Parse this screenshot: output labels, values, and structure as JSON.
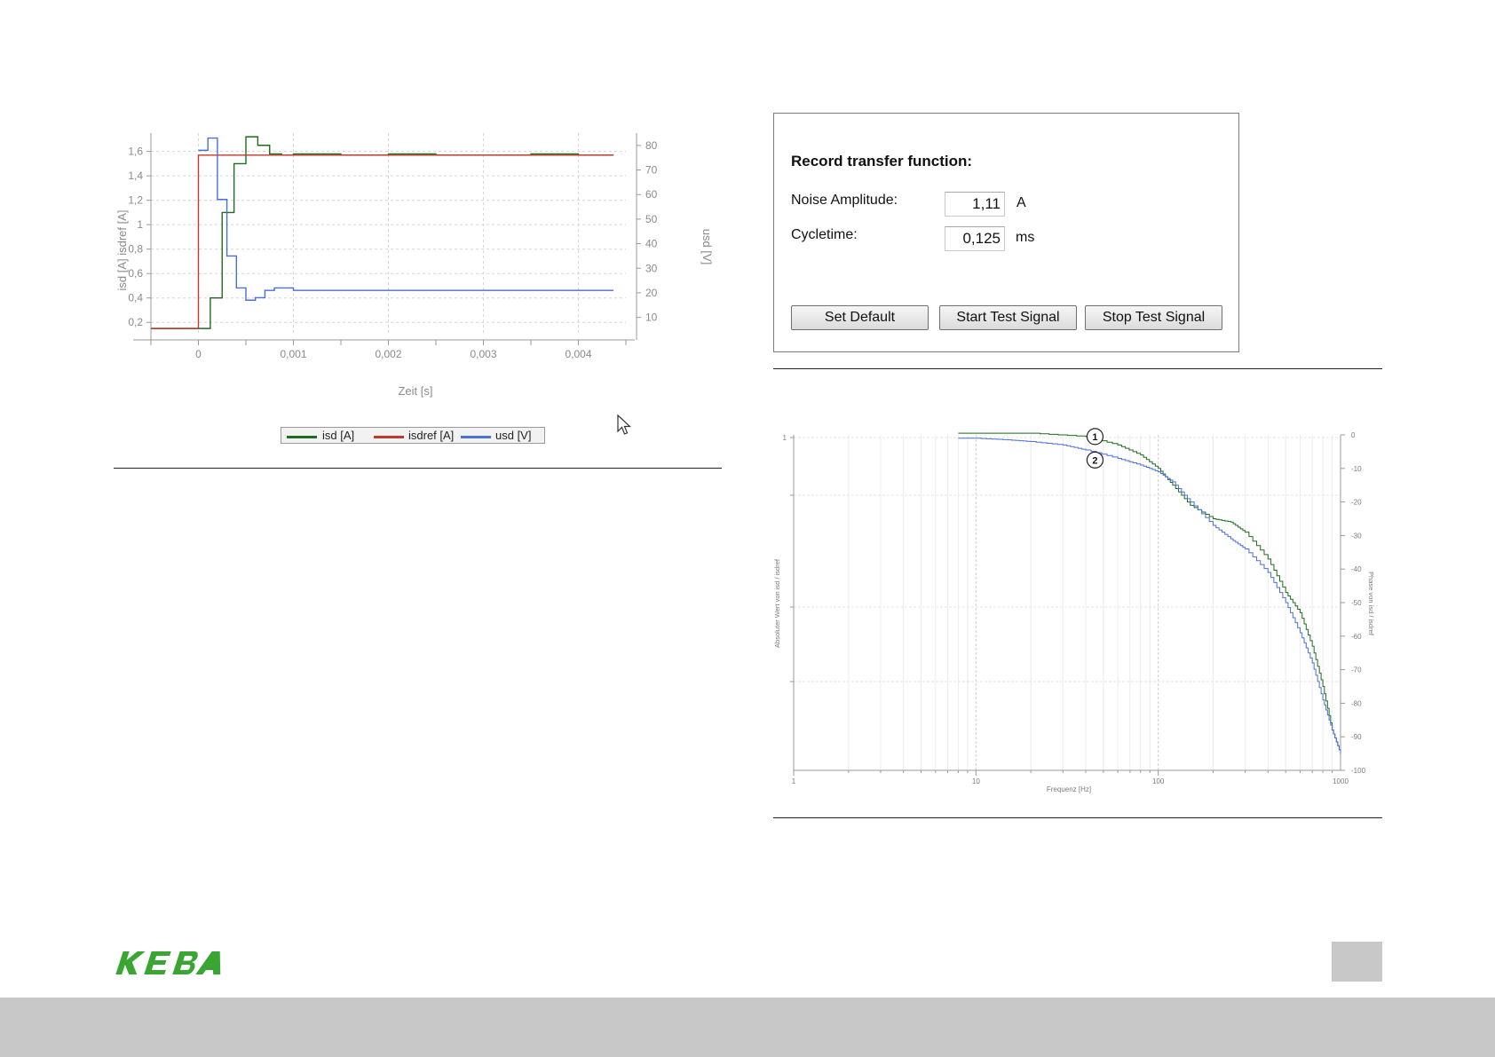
{
  "step_chart": {
    "x_ticks": [
      "0",
      "0,001",
      "0,002",
      "0,003",
      "0,004"
    ],
    "y_left_ticks": [
      "0,2",
      "0,4",
      "0,6",
      "0,8",
      "1",
      "1,2",
      "1,4",
      "1,6"
    ],
    "y_right_ticks": [
      "10",
      "20",
      "30",
      "40",
      "50",
      "60",
      "70",
      "80"
    ],
    "xlabel": "Zeit [s]",
    "ylabel_left": "isd [A]  isdref [A]",
    "ylabel_right": "usd [V]"
  },
  "legend": {
    "items": [
      {
        "label": "isd [A]",
        "color": "#1f6b1f"
      },
      {
        "label": "isdref [A]",
        "color": "#c0392b"
      },
      {
        "label": "usd [V]",
        "color": "#4a6fd6"
      }
    ]
  },
  "dialog": {
    "title": "Record transfer function:",
    "noise_label": "Noise Amplitude:",
    "noise_value": "1,11",
    "noise_unit": "A",
    "cycle_label": "Cycletime:",
    "cycle_value": "0,125",
    "cycle_unit": "ms",
    "buttons": {
      "default": "Set Default",
      "start": "Start Test Signal",
      "stop": "Stop Test Signal"
    }
  },
  "bode_chart": {
    "x_ticks": [
      "1",
      "10",
      "100",
      "1000"
    ],
    "y_left_ticks": [
      "1"
    ],
    "y_right_ticks": [
      "0",
      "-10",
      "-20",
      "-30",
      "-40",
      "-50",
      "-60",
      "-70",
      "-80",
      "-90",
      "-100"
    ],
    "xlabel": "Frequenz [Hz]",
    "ylabel_left": "Absoluter Wert von isd / isdref",
    "ylabel_right": "Phase von isd / isdref",
    "markers": [
      "1",
      "2"
    ]
  },
  "chart_data": [
    {
      "type": "line",
      "xlabel": "Zeit [s]",
      "ylabel": "isd [A]  isdref [A]",
      "y2label": "usd [V]",
      "xlim": [
        -0.0005,
        0.0045
      ],
      "ylim": [
        0.1,
        1.75
      ],
      "y2lim": [
        3,
        85
      ],
      "grid": true,
      "legend": "bottom",
      "series": [
        {
          "name": "isd [A]",
          "axis": "left",
          "color": "#1f6b1f",
          "x": [
            -0.0005,
            -0.000375,
            -0.00025,
            -0.000125,
            0,
            0.000125,
            0.00025,
            0.000375,
            0.0005,
            0.000625,
            0.00075,
            0.000875,
            0.001,
            0.0015,
            0.002,
            0.0025,
            0.003,
            0.0035,
            0.004,
            0.00437
          ],
          "y": [
            0.15,
            0.15,
            0.15,
            0.15,
            0.15,
            0.4,
            1.1,
            1.5,
            1.72,
            1.65,
            1.58,
            1.57,
            1.58,
            1.57,
            1.58,
            1.57,
            1.57,
            1.58,
            1.57,
            1.57
          ]
        },
        {
          "name": "isdref [A]",
          "axis": "left",
          "color": "#c0392b",
          "x": [
            -0.0005,
            0,
            0,
            0.00437
          ],
          "y": [
            0.15,
            0.15,
            1.57,
            1.57
          ]
        },
        {
          "name": "usd [V]",
          "axis": "right",
          "color": "#4a6fd6",
          "x": [
            0,
            0.0001,
            0.0002,
            0.0003,
            0.0004,
            0.0005,
            0.0006,
            0.0007,
            0.0008,
            0.001,
            0.0015,
            0.002,
            0.0025,
            0.003,
            0.0035,
            0.004,
            0.00437
          ],
          "y": [
            78,
            83,
            58,
            35,
            22,
            17,
            18,
            21,
            22,
            21,
            21,
            21,
            21,
            21,
            21,
            21,
            21
          ]
        }
      ]
    },
    {
      "type": "line",
      "xlabel": "Frequenz [Hz]",
      "ylabel": "Absoluter Wert von isd / isdref",
      "y2label": "Phase von isd / isdref",
      "xscale": "log",
      "xlim": [
        1,
        1000
      ],
      "y2lim": [
        -100,
        0
      ],
      "grid": true,
      "series": [
        {
          "name": "1",
          "axis": "right",
          "color": "#1f6b1f",
          "x": [
            8,
            20,
            40,
            60,
            80,
            100,
            120,
            150,
            200,
            250,
            300,
            400,
            500,
            600,
            700,
            800,
            900,
            1000
          ],
          "y": [
            0.5,
            0.5,
            -0.5,
            -3,
            -6,
            -10,
            -15,
            -21,
            -25,
            -26,
            -29,
            -37,
            -47,
            -53,
            -63,
            -75,
            -88,
            -95
          ]
        },
        {
          "name": "2",
          "axis": "right",
          "color": "#4a6fd6",
          "x": [
            8,
            10,
            15,
            20,
            30,
            40,
            60,
            80,
            100,
            120,
            150,
            200,
            250,
            300,
            400,
            500,
            600,
            700,
            800,
            900,
            1000
          ],
          "y": [
            -1,
            -1,
            -1.5,
            -2,
            -3,
            -4.5,
            -7,
            -9,
            -11,
            -14,
            -20,
            -27,
            -31,
            -34,
            -41,
            -50,
            -59,
            -68,
            -79,
            -88,
            -95
          ]
        }
      ]
    }
  ]
}
